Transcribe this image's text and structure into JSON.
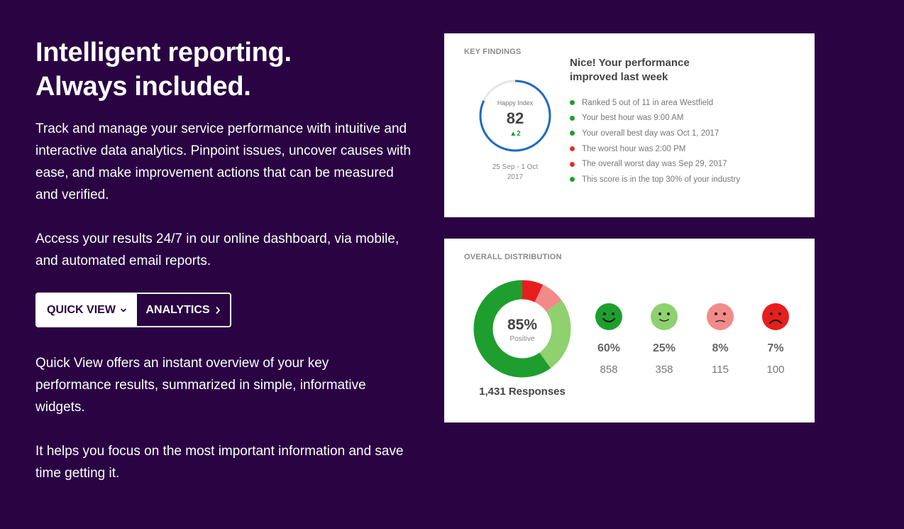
{
  "hero": {
    "title_line1": "Intelligent reporting.",
    "title_line2": "Always included.",
    "para1": "Track and manage your service performance with intuitive and interactive data analytics. Pinpoint issues, uncover causes with ease, and make improvement actions that can be measured and verified.",
    "para2": "Access your results 24/7 in our online dashboard, via mobile, and automated email reports.",
    "para3": "Quick View offers an instant overview of your key performance results, summarized in simple, informative widgets.",
    "para4": "It helps you focus on the most important information and save time getting it."
  },
  "tabs": {
    "quick_view": "QUICK VIEW",
    "analytics": "ANALYTICS"
  },
  "key_findings": {
    "label": "KEY FINDINGS",
    "happy_index_label": "Happy Index",
    "happy_index_value": "82",
    "happy_index_change": "▲2",
    "date_range": "25 Sep - 1 Oct 2017",
    "title": "Nice! Your performance improved last week",
    "items": [
      {
        "text": "Ranked 5 out of 11 in area Westfield",
        "status": "good"
      },
      {
        "text": "Your best hour was 9:00 AM",
        "status": "good"
      },
      {
        "text": "Your overall best day was Oct 1, 2017",
        "status": "good"
      },
      {
        "text": "The worst hour was 2:00 PM",
        "status": "bad"
      },
      {
        "text": "The overall worst day was Sep 29, 2017",
        "status": "bad"
      },
      {
        "text": "This score is in the top 30% of your industry",
        "status": "good"
      }
    ]
  },
  "distribution": {
    "label": "OVERALL DISTRIBUTION",
    "positive_pct": "85%",
    "positive_label": "Positive",
    "responses": "1,431 Responses",
    "faces": [
      {
        "icon": "very-happy-face-icon",
        "pct": "60%",
        "count": "858",
        "color": "#1e9e2e"
      },
      {
        "icon": "happy-face-icon",
        "pct": "25%",
        "count": "358",
        "color": "#8fd06f"
      },
      {
        "icon": "unhappy-face-icon",
        "pct": "8%",
        "count": "115",
        "color": "#f28a8a"
      },
      {
        "icon": "very-unhappy-face-icon",
        "pct": "7%",
        "count": "100",
        "color": "#e61e1e"
      }
    ]
  },
  "colors": {
    "background": "#2a0343",
    "good": "#1e9e2e",
    "bad": "#e03030",
    "ring": "#1f6bbf"
  }
}
